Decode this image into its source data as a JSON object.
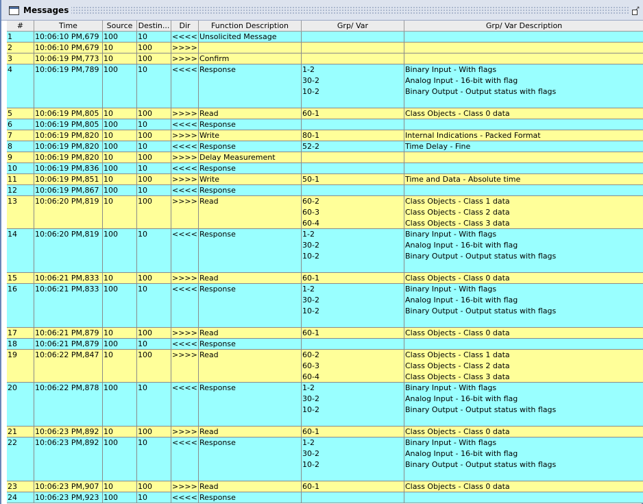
{
  "window": {
    "title": "Messages"
  },
  "columns": [
    "#",
    "Time",
    "Source",
    "Destin...",
    "Dir",
    "Function Description",
    "Grp/ Var",
    "Grp/ Var Description"
  ],
  "rows": [
    {
      "num": "1",
      "time": "10:06:10 PM,679",
      "src": "100",
      "dst": "10",
      "dir": "<<<<",
      "func": "Unsolicited Message",
      "gv": [],
      "desc": [],
      "color": "c",
      "lines": 1
    },
    {
      "num": "2",
      "time": "10:06:10 PM,679",
      "src": "10",
      "dst": "100",
      "dir": ">>>>",
      "func": "",
      "gv": [],
      "desc": [],
      "color": "y",
      "lines": 1
    },
    {
      "num": "3",
      "time": "10:06:19 PM,773",
      "src": "10",
      "dst": "100",
      "dir": ">>>>",
      "func": "Confirm",
      "gv": [],
      "desc": [],
      "color": "y",
      "lines": 1
    },
    {
      "num": "4",
      "time": "10:06:19 PM,789",
      "src": "100",
      "dst": "10",
      "dir": "<<<<",
      "func": "Response",
      "gv": [
        "1-2",
        "30-2",
        "10-2"
      ],
      "desc": [
        "Binary Input - With flags",
        "Analog Input - 16-bit with flag",
        "Binary Output - Output status with flags"
      ],
      "color": "c",
      "lines": 4
    },
    {
      "num": "5",
      "time": "10:06:19 PM,805",
      "src": "10",
      "dst": "100",
      "dir": ">>>>",
      "func": "Read",
      "gv": [
        "60-1"
      ],
      "desc": [
        "Class Objects - Class 0 data"
      ],
      "color": "y",
      "lines": 1
    },
    {
      "num": "6",
      "time": "10:06:19 PM,805",
      "src": "100",
      "dst": "10",
      "dir": "<<<<",
      "func": "Response",
      "gv": [],
      "desc": [],
      "color": "c",
      "lines": 1
    },
    {
      "num": "7",
      "time": "10:06:19 PM,820",
      "src": "10",
      "dst": "100",
      "dir": ">>>>",
      "func": "Write",
      "gv": [
        "80-1"
      ],
      "desc": [
        "Internal Indications - Packed Format"
      ],
      "color": "y",
      "lines": 1
    },
    {
      "num": "8",
      "time": "10:06:19 PM,820",
      "src": "100",
      "dst": "10",
      "dir": "<<<<",
      "func": "Response",
      "gv": [
        "52-2"
      ],
      "desc": [
        "Time Delay - Fine"
      ],
      "color": "c",
      "lines": 1
    },
    {
      "num": "9",
      "time": "10:06:19 PM,820",
      "src": "10",
      "dst": "100",
      "dir": ">>>>",
      "func": "Delay Measurement",
      "gv": [],
      "desc": [],
      "color": "y",
      "lines": 1
    },
    {
      "num": "10",
      "time": "10:06:19 PM,836",
      "src": "100",
      "dst": "10",
      "dir": "<<<<",
      "func": "Response",
      "gv": [],
      "desc": [],
      "color": "c",
      "lines": 1
    },
    {
      "num": "11",
      "time": "10:06:19 PM,851",
      "src": "10",
      "dst": "100",
      "dir": ">>>>",
      "func": "Write",
      "gv": [
        "50-1"
      ],
      "desc": [
        "Time and Data - Absolute time"
      ],
      "color": "y",
      "lines": 1
    },
    {
      "num": "12",
      "time": "10:06:19 PM,867",
      "src": "100",
      "dst": "10",
      "dir": "<<<<",
      "func": "Response",
      "gv": [],
      "desc": [],
      "color": "c",
      "lines": 1
    },
    {
      "num": "13",
      "time": "10:06:20 PM,819",
      "src": "10",
      "dst": "100",
      "dir": ">>>>",
      "func": "Read",
      "gv": [
        "60-2",
        "60-3",
        "60-4"
      ],
      "desc": [
        "Class Objects - Class 1 data",
        "Class Objects - Class 2 data",
        "Class Objects - Class 3 data"
      ],
      "color": "y",
      "lines": 3
    },
    {
      "num": "14",
      "time": "10:06:20 PM,819",
      "src": "100",
      "dst": "10",
      "dir": "<<<<",
      "func": "Response",
      "gv": [
        "1-2",
        "30-2",
        "10-2"
      ],
      "desc": [
        "Binary Input - With flags",
        "Analog Input - 16-bit with flag",
        "Binary Output - Output status with flags"
      ],
      "color": "c",
      "lines": 4
    },
    {
      "num": "15",
      "time": "10:06:21 PM,833",
      "src": "10",
      "dst": "100",
      "dir": ">>>>",
      "func": "Read",
      "gv": [
        "60-1"
      ],
      "desc": [
        "Class Objects - Class 0 data"
      ],
      "color": "y",
      "lines": 1
    },
    {
      "num": "16",
      "time": "10:06:21 PM,833",
      "src": "100",
      "dst": "10",
      "dir": "<<<<",
      "func": "Response",
      "gv": [
        "1-2",
        "30-2",
        "10-2"
      ],
      "desc": [
        "Binary Input - With flags",
        "Analog Input - 16-bit with flag",
        "Binary Output - Output status with flags"
      ],
      "color": "c",
      "lines": 4
    },
    {
      "num": "17",
      "time": "10:06:21 PM,879",
      "src": "10",
      "dst": "100",
      "dir": ">>>>",
      "func": "Read",
      "gv": [
        "60-1"
      ],
      "desc": [
        "Class Objects - Class 0 data"
      ],
      "color": "y",
      "lines": 1
    },
    {
      "num": "18",
      "time": "10:06:21 PM,879",
      "src": "100",
      "dst": "10",
      "dir": "<<<<",
      "func": "Response",
      "gv": [],
      "desc": [],
      "color": "c",
      "lines": 1
    },
    {
      "num": "19",
      "time": "10:06:22 PM,847",
      "src": "10",
      "dst": "100",
      "dir": ">>>>",
      "func": "Read",
      "gv": [
        "60-2",
        "60-3",
        "60-4"
      ],
      "desc": [
        "Class Objects - Class 1 data",
        "Class Objects - Class 2 data",
        "Class Objects - Class 3 data"
      ],
      "color": "y",
      "lines": 3
    },
    {
      "num": "20",
      "time": "10:06:22 PM,878",
      "src": "100",
      "dst": "10",
      "dir": "<<<<",
      "func": "Response",
      "gv": [
        "1-2",
        "30-2",
        "10-2"
      ],
      "desc": [
        "Binary Input - With flags",
        "Analog Input - 16-bit with flag",
        "Binary Output - Output status with flags"
      ],
      "color": "c",
      "lines": 4
    },
    {
      "num": "21",
      "time": "10:06:23 PM,892",
      "src": "10",
      "dst": "100",
      "dir": ">>>>",
      "func": "Read",
      "gv": [
        "60-1"
      ],
      "desc": [
        "Class Objects - Class 0 data"
      ],
      "color": "y",
      "lines": 1
    },
    {
      "num": "22",
      "time": "10:06:23 PM,892",
      "src": "100",
      "dst": "10",
      "dir": "<<<<",
      "func": "Response",
      "gv": [
        "1-2",
        "30-2",
        "10-2"
      ],
      "desc": [
        "Binary Input - With flags",
        "Analog Input - 16-bit with flag",
        "Binary Output - Output status with flags"
      ],
      "color": "c",
      "lines": 4
    },
    {
      "num": "23",
      "time": "10:06:23 PM,907",
      "src": "10",
      "dst": "100",
      "dir": ">>>>",
      "func": "Read",
      "gv": [
        "60-1"
      ],
      "desc": [
        "Class Objects - Class 0 data"
      ],
      "color": "y",
      "lines": 1
    },
    {
      "num": "24",
      "time": "10:06:23 PM,923",
      "src": "100",
      "dst": "10",
      "dir": "<<<<",
      "func": "Response",
      "gv": [],
      "desc": [],
      "color": "c",
      "lines": 1
    }
  ],
  "colors": {
    "request_row": "#ffff99",
    "response_row": "#99ffff",
    "header_bg": "#ececec",
    "titlebar_bg": "#dde3ee"
  },
  "icons": {
    "window_icon": "window-icon",
    "restore_icon": "restore-icon"
  }
}
